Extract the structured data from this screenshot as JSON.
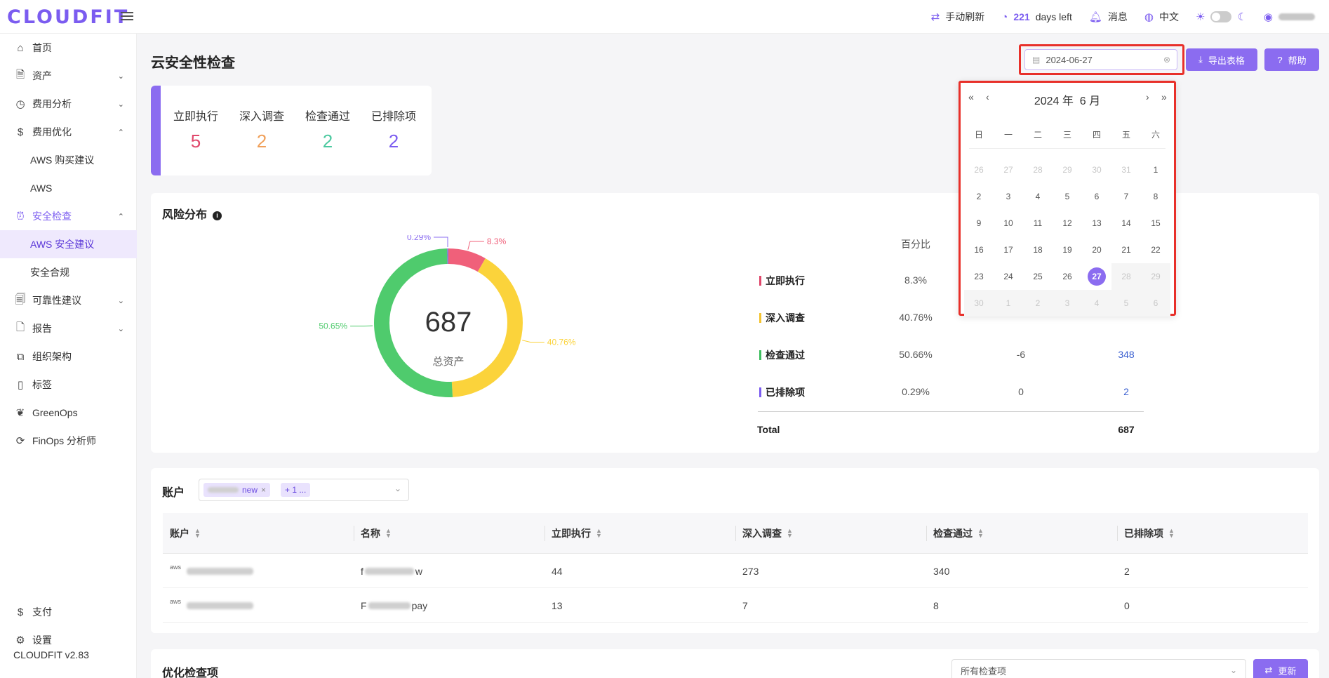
{
  "topbar": {
    "logo": "CLOUDFIT",
    "refresh": "手动刷新",
    "days_num": "221",
    "days_text": "days left",
    "messages": "消息",
    "language": "中文"
  },
  "sidebar": {
    "items": [
      {
        "label": "首页",
        "icon": "home-icon"
      },
      {
        "label": "资产",
        "icon": "asset-icon"
      },
      {
        "label": "费用分析",
        "icon": "gauge-icon"
      },
      {
        "label": "费用优化",
        "icon": "dollar-icon"
      },
      {
        "label": "AWS 购买建议"
      },
      {
        "label": "AWS"
      },
      {
        "label": "安全检查",
        "icon": "alarm-icon"
      },
      {
        "label": "AWS 安全建议"
      },
      {
        "label": "安全合规"
      },
      {
        "label": "可靠性建议",
        "icon": "reliability-icon"
      },
      {
        "label": "报告",
        "icon": "report-icon"
      },
      {
        "label": "组织架构",
        "icon": "org-icon"
      },
      {
        "label": "标签",
        "icon": "tag-icon"
      },
      {
        "label": "GreenOps",
        "icon": "leaf-icon"
      },
      {
        "label": "FinOps 分析师",
        "icon": "analyst-icon"
      },
      {
        "label": "支付",
        "icon": "payment-icon"
      },
      {
        "label": "设置",
        "icon": "gear-icon"
      }
    ],
    "version": "CLOUDFIT v2.83"
  },
  "header": {
    "title": "云安全性检查",
    "date_value": "2024-06-27",
    "export_label": "导出表格",
    "help_label": "帮助"
  },
  "summary": [
    {
      "label": "立即执行",
      "value": "5",
      "color": "#e0476b"
    },
    {
      "label": "深入调查",
      "value": "2",
      "color": "#f0a05a"
    },
    {
      "label": "检查通过",
      "value": "2",
      "color": "#4cc9a0"
    },
    {
      "label": "已排除项",
      "value": "2",
      "color": "#7b5cf0"
    }
  ],
  "risk": {
    "title": "风险分布",
    "total_value": "687",
    "total_label": "总资产",
    "slices": [
      {
        "label": "立即执行",
        "pct": 8.3,
        "pct_text": "8.3%",
        "color": "#f0607a"
      },
      {
        "label": "深入调查",
        "pct": 40.76,
        "pct_text": "40.76%",
        "color": "#fbd33b"
      },
      {
        "label": "检查通过",
        "pct": 50.65,
        "pct_text": "50.65%",
        "color": "#4fcb6d"
      },
      {
        "label": "已排除项",
        "pct": 0.29,
        "pct_text": "0.29%",
        "color": "#8b6cf0"
      }
    ],
    "table_header_pct": "百分比",
    "rows": [
      {
        "name": "立即执行",
        "pct": "8.3%",
        "color": "#e0476b"
      },
      {
        "name": "深入调查",
        "pct": "40.76%",
        "color": "#f4c330"
      },
      {
        "name": "检查通过",
        "pct": "50.66%",
        "delta": "-6",
        "count": "348",
        "color": "#3fbf60"
      },
      {
        "name": "已排除项",
        "pct": "0.29%",
        "delta": "0",
        "count": "2",
        "color": "#7b5cf0"
      }
    ],
    "total_label_row": "Total",
    "total_count": "687"
  },
  "accounts": {
    "title": "账户",
    "tag1_suffix": "new",
    "tag2": "+ 1 ...",
    "columns": [
      "账户",
      "名称",
      "立即执行",
      "深入调查",
      "检查通过",
      "已排除项"
    ],
    "rows": [
      {
        "name_prefix": "f",
        "name_suffix": "w",
        "c1": "44",
        "c2": "273",
        "c3": "340",
        "c4": "2"
      },
      {
        "name_prefix": "F",
        "name_suffix": "pay",
        "c1": "13",
        "c2": "7",
        "c3": "8",
        "c4": "0"
      }
    ]
  },
  "optimize": {
    "title": "优化检查项",
    "select_value": "所有检查项",
    "refresh_label": "更新"
  },
  "calendar": {
    "year_label": "2024 年",
    "month_label": "6 月",
    "weekdays": [
      "日",
      "一",
      "二",
      "三",
      "四",
      "五",
      "六"
    ],
    "days": [
      [
        "26",
        "27",
        "28",
        "29",
        "30",
        "31",
        "1"
      ],
      [
        "2",
        "3",
        "4",
        "5",
        "6",
        "7",
        "8"
      ],
      [
        "9",
        "10",
        "11",
        "12",
        "13",
        "14",
        "15"
      ],
      [
        "16",
        "17",
        "18",
        "19",
        "20",
        "21",
        "22"
      ],
      [
        "23",
        "24",
        "25",
        "26",
        "27",
        "28",
        "29"
      ],
      [
        "30",
        "1",
        "2",
        "3",
        "4",
        "5",
        "6"
      ]
    ],
    "selected": "27"
  }
}
